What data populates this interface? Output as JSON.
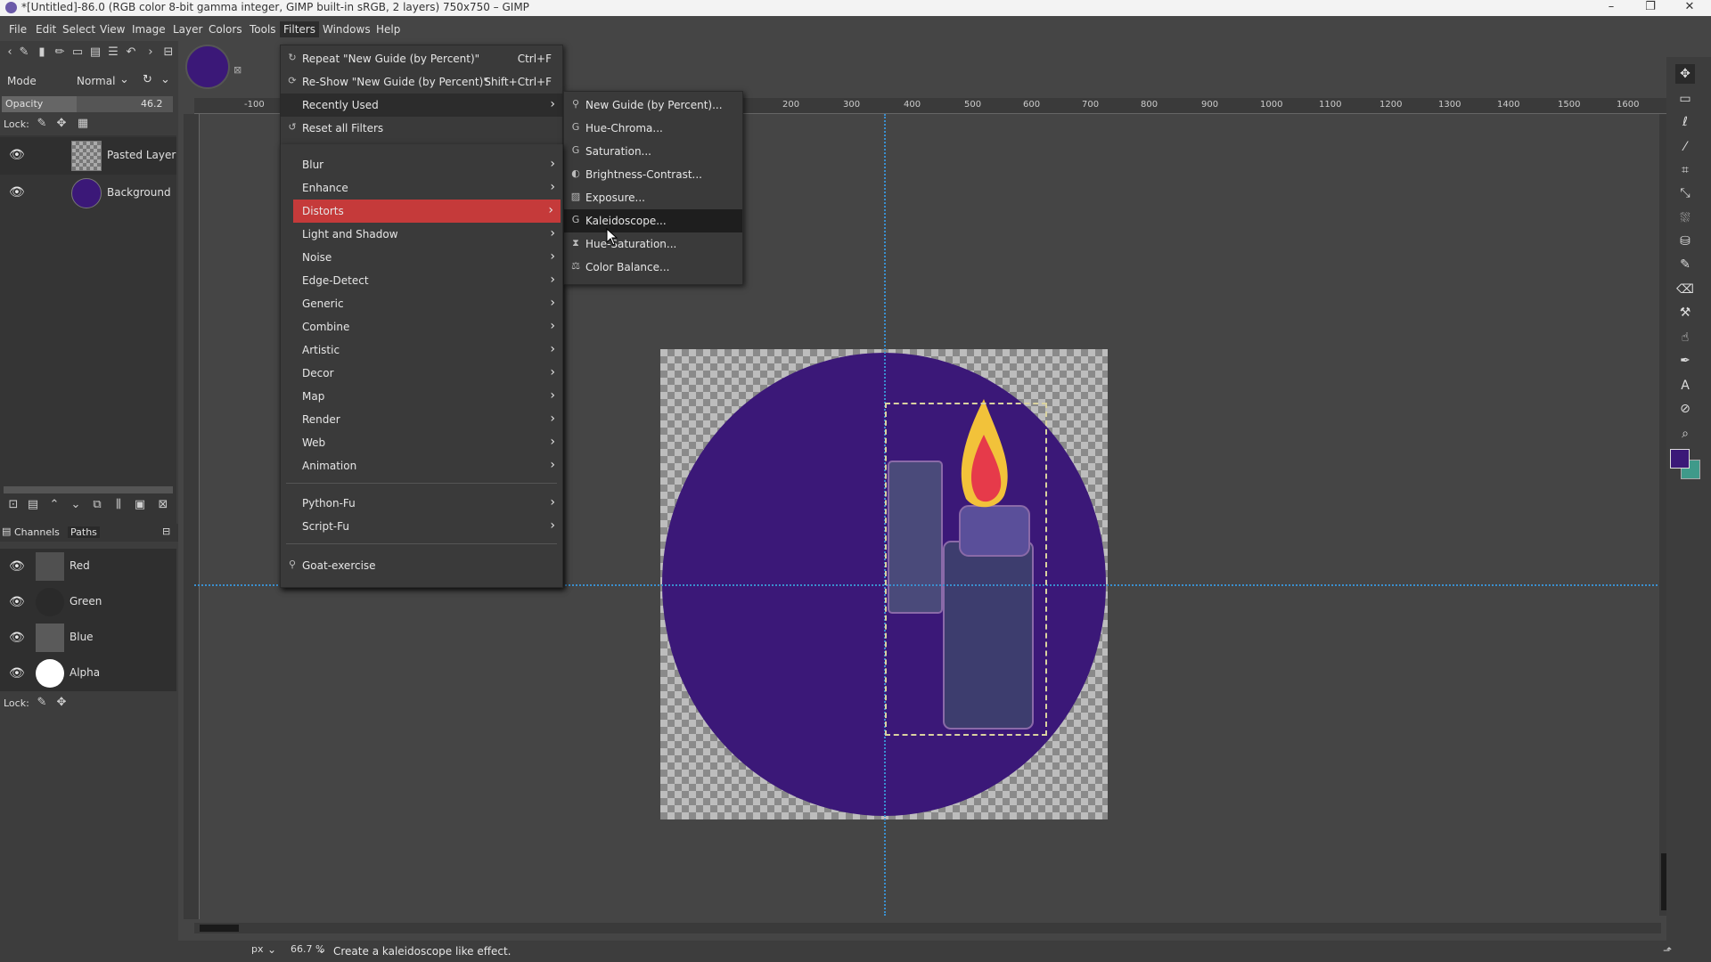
{
  "window": {
    "title": "*[Untitled]-86.0 (RGB color 8-bit gamma integer, GIMP built-in sRGB, 2 layers) 750x750 – GIMP"
  },
  "menubar": [
    "File",
    "Edit",
    "Select",
    "View",
    "Image",
    "Layer",
    "Colors",
    "Tools",
    "Filters",
    "Windows",
    "Help"
  ],
  "layers_panel": {
    "mode_label": "Mode",
    "mode_value": "Normal",
    "opacity_label": "Opacity",
    "opacity_value": "46.2",
    "lock_label": "Lock:",
    "layers": [
      {
        "name": "Pasted Layer"
      },
      {
        "name": "Background"
      }
    ]
  },
  "channels_panel": {
    "tab_channels": "Channels",
    "tab_paths": "Paths",
    "channels": [
      "Red",
      "Green",
      "Blue",
      "Alpha"
    ],
    "lock_label": "Lock:"
  },
  "filters_menu": {
    "top": [
      {
        "label": "Repeat \"New Guide (by Percent)\"",
        "shortcut": "Ctrl+F"
      },
      {
        "label": "Re-Show \"New Guide (by Percent)\"",
        "shortcut": "Shift+Ctrl+F"
      },
      {
        "label": "Recently Used"
      },
      {
        "label": "Reset all Filters"
      }
    ],
    "categories": [
      "Blur",
      "Enhance",
      "Distorts",
      "Light and Shadow",
      "Noise",
      "Edge-Detect",
      "Generic",
      "Combine",
      "Artistic",
      "Decor",
      "Map",
      "Render",
      "Web",
      "Animation"
    ],
    "scripts": [
      "Python-Fu",
      "Script-Fu"
    ],
    "bottom": "Goat-exercise"
  },
  "recent_submenu": [
    "New Guide (by Percent)...",
    "Hue-Chroma...",
    "Saturation...",
    "Brightness-Contrast...",
    "Exposure...",
    "Kaleidoscope...",
    "Hue-Saturation...",
    "Color Balance..."
  ],
  "ruler_labels": [
    "200",
    "300",
    "400",
    "500",
    "600",
    "700",
    "800",
    "900",
    "1000",
    "1100",
    "1200",
    "1300",
    "1400",
    "1500",
    "1600"
  ],
  "ruler_left_label": "-100",
  "statusbar": {
    "unit": "px",
    "zoom": "66.7 %",
    "message": "Create a kaleidoscope like effect."
  },
  "colors": {
    "accent_red": "#c53a3a",
    "circle": "#3b1878",
    "guide": "#3a8fcf",
    "fg_swatch": "#3b1878",
    "bg_swatch": "#3f9a8a"
  }
}
